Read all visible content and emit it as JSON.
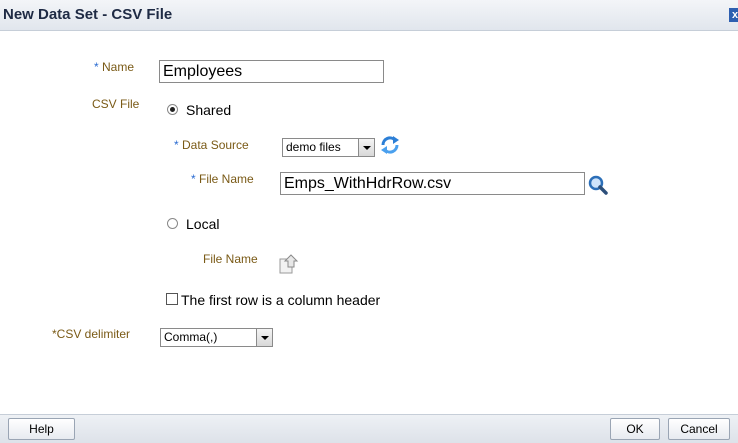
{
  "dialog": {
    "title": "New Data Set - CSV File",
    "close_glyph": "x"
  },
  "form": {
    "name_label_req": "*",
    "name_label": " Name",
    "name_value": "Employees",
    "csv_file_label": "CSV File",
    "shared_label": "Shared",
    "shared_selected": true,
    "data_source_label_req": "*",
    "data_source_label": " Data Source",
    "data_source_value": "demo files",
    "refresh_icon": "refresh-icon",
    "shared_file_name_label_req": "*",
    "shared_file_name_label": " File Name",
    "shared_file_name_value": "Emps_WithHdrRow.csv",
    "search_icon": "search-icon",
    "local_label": "Local",
    "local_selected": false,
    "local_file_name_label": "File Name",
    "upload_icon": "upload-icon",
    "header_checkbox_label": "The first row is a column header",
    "header_checkbox_checked": false,
    "delimiter_label": "*CSV delimiter",
    "delimiter_value": "Comma(,)"
  },
  "footer": {
    "help_label": "Help",
    "ok_label": "OK",
    "cancel_label": "Cancel"
  },
  "colors": {
    "label": "#7a5a16",
    "required": "#2a6bd1",
    "title": "#1e2a44"
  }
}
